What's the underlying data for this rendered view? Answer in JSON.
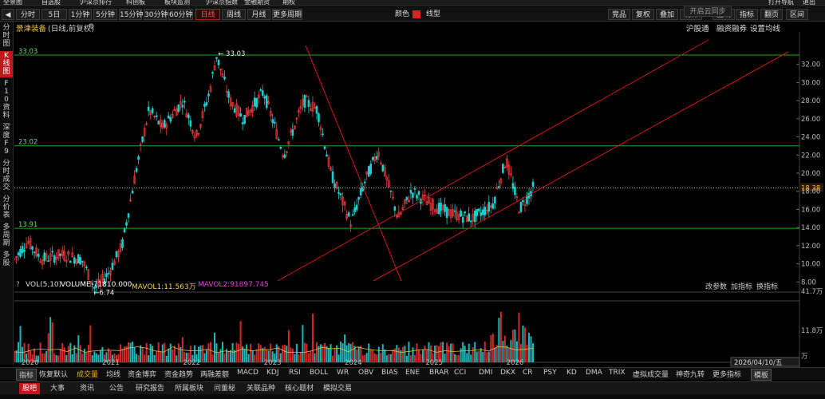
{
  "menu": [
    "全景图",
    "自选股",
    "沪深京排行",
    "科创板",
    "板块监测",
    "沪深京指数",
    "金融期货",
    "期权"
  ],
  "menu_right": [
    "打开导航",
    "退出"
  ],
  "periods": [
    "分时",
    "5日",
    "1分钟",
    "5分钟",
    "15分钟",
    "30分钟",
    "60分钟",
    "日线",
    "周线",
    "月线",
    "更多周期"
  ],
  "active_period": "日线",
  "toolbar": {
    "color_label": "颜色",
    "line_label": "线型"
  },
  "right_tools": [
    "竞品",
    "复权",
    "叠加",
    "统计",
    "画线",
    "指标",
    "翻页",
    "区间"
  ],
  "stock": {
    "name": "景津装备",
    "mode": "(日线,前复权)"
  },
  "top_links": [
    "沪股通",
    "融资融券",
    "设置均线"
  ],
  "left_tabs": [
    "分时图",
    "K线图",
    "F10资料",
    "深度F9",
    "分时成交",
    "分价表",
    "多周期",
    "多股"
  ],
  "price_levels": {
    "high": "33.03",
    "mid": "23.02",
    "low": "13.91",
    "current": "18.38"
  },
  "callouts": {
    "max": "33.03",
    "min": "6.74"
  },
  "y_ticks": [
    "32.00",
    "30.00",
    "28.00",
    "26.00",
    "24.00",
    "22.00",
    "20.00",
    "18.00",
    "16.00",
    "14.00",
    "12.00",
    "10.00",
    "8.00"
  ],
  "volume": {
    "title": "VOL(5,10)",
    "volume": "VOLUME:71810.000",
    "mavol1": "MAVOL1:11.563万",
    "mavol2": "MAVOL2:91897.745",
    "buttons": [
      "改参数",
      "加指标",
      "换指标"
    ],
    "ticks": [
      "41.7万",
      "11.8万",
      "万"
    ]
  },
  "x_labels": [
    "2020",
    "2021",
    "2022",
    "2023",
    "2024",
    "2025",
    "2026"
  ],
  "date_label": "2026/04/10/五",
  "indicators": [
    "指标",
    "恢复默认",
    "成交量",
    "均线",
    "资金博弈",
    "资金趋势",
    "两融差额",
    "MACD",
    "KDJ",
    "RSI",
    "BOLL",
    "WR",
    "OBV",
    "BIAS",
    "ENE",
    "BRAR",
    "CCI",
    "DMI",
    "DKX",
    "CR",
    "PSY",
    "KD",
    "DMA",
    "TRIX",
    "虚拟成交量",
    "神奇九转",
    "更多指标",
    "模板"
  ],
  "footer_tabs": [
    "股吧",
    "大事",
    "资讯",
    "公告",
    "研究报告",
    "所属板块",
    "问董秘",
    "关联品种",
    "核心题材",
    "模拟交易"
  ],
  "colors": {
    "up": "#ff3b3b",
    "down": "#19d0d0",
    "level_line": "#1fa31f",
    "trend_line": "#d01818",
    "background": "#000000"
  },
  "chart_data": {
    "type": "candlestick",
    "xlabel": "",
    "ylabel": "",
    "ylim": [
      6,
      34
    ],
    "x_categories": [
      "2020",
      "2021",
      "2022",
      "2023",
      "2024",
      "2025",
      "2026"
    ],
    "close_trend": [
      {
        "x": "2019-11",
        "y": 10.5
      },
      {
        "x": "2020-01",
        "y": 12.5
      },
      {
        "x": "2020-03",
        "y": 10.5
      },
      {
        "x": "2020-06",
        "y": 11.0
      },
      {
        "x": "2020-09",
        "y": 10.5
      },
      {
        "x": "2020-11",
        "y": 7.2
      },
      {
        "x": "2021-01",
        "y": 9.0
      },
      {
        "x": "2021-03",
        "y": 12.0
      },
      {
        "x": "2021-05",
        "y": 20.0
      },
      {
        "x": "2021-07",
        "y": 27.0
      },
      {
        "x": "2021-09",
        "y": 25.0
      },
      {
        "x": "2021-12",
        "y": 28.0
      },
      {
        "x": "2022-02",
        "y": 24.0
      },
      {
        "x": "2022-04",
        "y": 29.0
      },
      {
        "x": "2022-05",
        "y": 33.0
      },
      {
        "x": "2022-07",
        "y": 28.0
      },
      {
        "x": "2022-09",
        "y": 26.0
      },
      {
        "x": "2022-12",
        "y": 29.0
      },
      {
        "x": "2023-03",
        "y": 22.0
      },
      {
        "x": "2023-06",
        "y": 28.0
      },
      {
        "x": "2023-08",
        "y": 27.0
      },
      {
        "x": "2023-10",
        "y": 20.0
      },
      {
        "x": "2024-01",
        "y": 14.5
      },
      {
        "x": "2024-03",
        "y": 19.0
      },
      {
        "x": "2024-05",
        "y": 22.5
      },
      {
        "x": "2024-08",
        "y": 15.0
      },
      {
        "x": "2024-10",
        "y": 18.0
      },
      {
        "x": "2025-01",
        "y": 16.5
      },
      {
        "x": "2025-04",
        "y": 15.5
      },
      {
        "x": "2025-07",
        "y": 15.0
      },
      {
        "x": "2025-10",
        "y": 16.5
      },
      {
        "x": "2025-12",
        "y": 21.5
      },
      {
        "x": "2026-02",
        "y": 16.0
      },
      {
        "x": "2026-04",
        "y": 18.38
      }
    ]
  }
}
